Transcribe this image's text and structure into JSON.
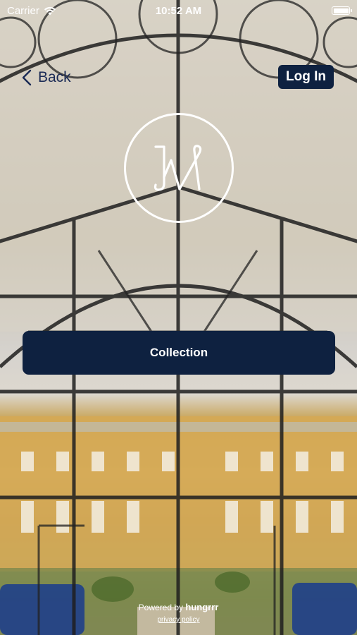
{
  "status_bar": {
    "carrier": "Carrier",
    "time": "10:52 AM"
  },
  "nav": {
    "back_label": "Back",
    "login_label": "Log In"
  },
  "main": {
    "collection_label": "Collection"
  },
  "footer": {
    "powered_prefix": "Powered by",
    "powered_brand": "hungrrr",
    "privacy_label": "privacy policy"
  },
  "colors": {
    "accent": "#0e2140",
    "back_text": "#1a2a55",
    "text_on_accent": "#ffffff"
  },
  "icons": {
    "wifi": "wifi-icon",
    "battery": "battery-icon",
    "back": "chevron-left-icon",
    "logo": "k-monogram-logo"
  }
}
